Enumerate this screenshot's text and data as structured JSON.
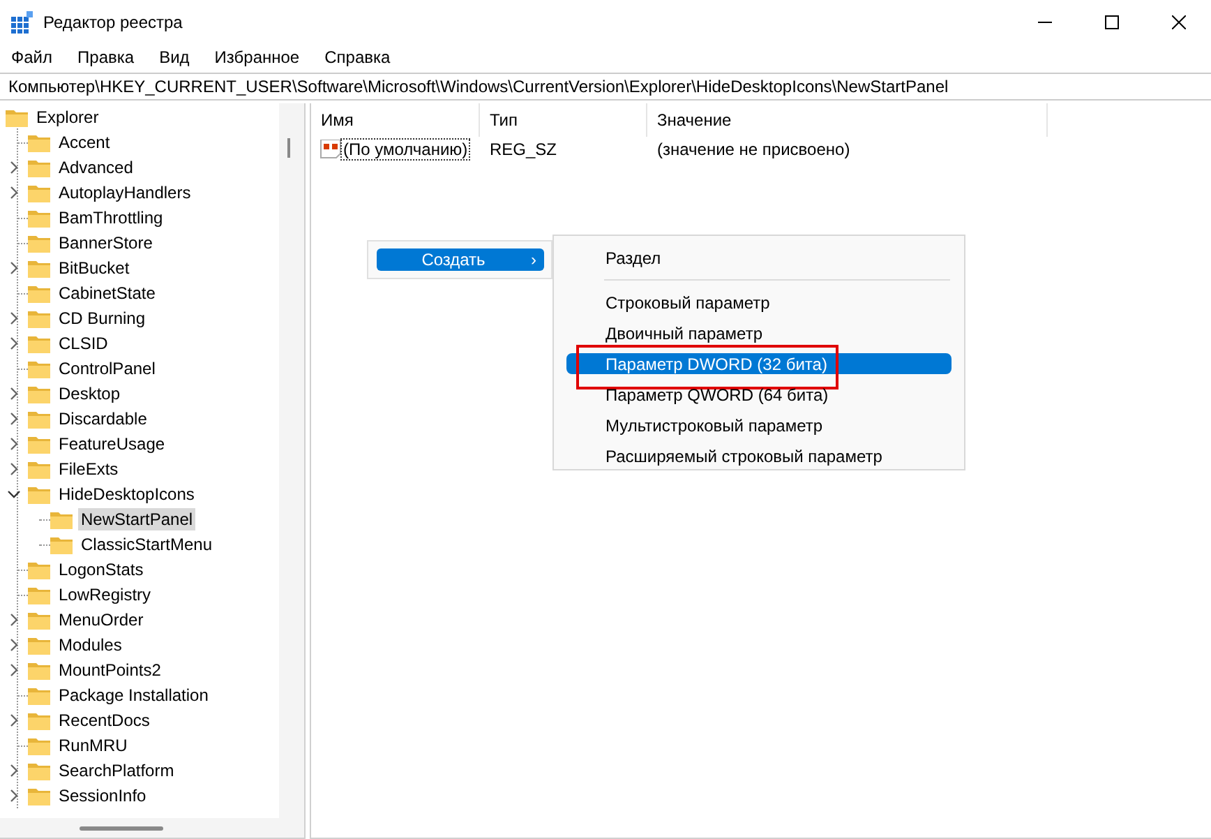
{
  "window": {
    "title": "Редактор реестра"
  },
  "menu_bar": [
    "Файл",
    "Правка",
    "Вид",
    "Избранное",
    "Справка"
  ],
  "address": "Компьютер\\HKEY_CURRENT_USER\\Software\\Microsoft\\Windows\\CurrentVersion\\Explorer\\HideDesktopIcons\\NewStartPanel",
  "tree": {
    "label": "Explorer",
    "selected": false,
    "children": [
      {
        "label": "Accent",
        "expandable": false,
        "selected": false
      },
      {
        "label": "Advanced",
        "expandable": true,
        "expanded": false,
        "selected": false
      },
      {
        "label": "AutoplayHandlers",
        "expandable": true,
        "expanded": false,
        "selected": false
      },
      {
        "label": "BamThrottling",
        "expandable": false,
        "selected": false
      },
      {
        "label": "BannerStore",
        "expandable": false,
        "selected": false
      },
      {
        "label": "BitBucket",
        "expandable": true,
        "expanded": false,
        "selected": false
      },
      {
        "label": "CabinetState",
        "expandable": false,
        "selected": false
      },
      {
        "label": "CD Burning",
        "expandable": true,
        "expanded": false,
        "selected": false
      },
      {
        "label": "CLSID",
        "expandable": true,
        "expanded": false,
        "selected": false
      },
      {
        "label": "ControlPanel",
        "expandable": false,
        "selected": false
      },
      {
        "label": "Desktop",
        "expandable": true,
        "expanded": false,
        "selected": false
      },
      {
        "label": "Discardable",
        "expandable": true,
        "expanded": false,
        "selected": false
      },
      {
        "label": "FeatureUsage",
        "expandable": true,
        "expanded": false,
        "selected": false
      },
      {
        "label": "FileExts",
        "expandable": true,
        "expanded": false,
        "selected": false
      },
      {
        "label": "HideDesktopIcons",
        "expandable": true,
        "expanded": true,
        "selected": false,
        "children": [
          {
            "label": "NewStartPanel",
            "expandable": false,
            "selected": true
          },
          {
            "label": "ClassicStartMenu",
            "expandable": false,
            "selected": false
          }
        ]
      },
      {
        "label": "LogonStats",
        "expandable": false,
        "selected": false
      },
      {
        "label": "LowRegistry",
        "expandable": false,
        "selected": false
      },
      {
        "label": "MenuOrder",
        "expandable": true,
        "expanded": false,
        "selected": false
      },
      {
        "label": "Modules",
        "expandable": true,
        "expanded": false,
        "selected": false
      },
      {
        "label": "MountPoints2",
        "expandable": true,
        "expanded": false,
        "selected": false
      },
      {
        "label": "Package Installation",
        "expandable": false,
        "selected": false
      },
      {
        "label": "RecentDocs",
        "expandable": true,
        "expanded": false,
        "selected": false
      },
      {
        "label": "RunMRU",
        "expandable": false,
        "selected": false
      },
      {
        "label": "SearchPlatform",
        "expandable": true,
        "expanded": false,
        "selected": false
      },
      {
        "label": "SessionInfo",
        "expandable": true,
        "expanded": false,
        "selected": false
      }
    ]
  },
  "table": {
    "columns": [
      "Имя",
      "Тип",
      "Значение"
    ],
    "rows": [
      {
        "name": "(По умолчанию)",
        "type": "REG_SZ",
        "value": "(значение не присвоено)"
      }
    ]
  },
  "context_menu": {
    "items": [
      {
        "label": "Создать",
        "arrow": "›",
        "selected": true
      }
    ]
  },
  "submenu": {
    "items": [
      {
        "label": "Раздел",
        "selected": false,
        "annotated": false,
        "separator_after": true
      },
      {
        "label": "Строковый параметр",
        "selected": false,
        "annotated": false,
        "separator_after": false
      },
      {
        "label": "Двоичный параметр",
        "selected": false,
        "annotated": false,
        "separator_after": false
      },
      {
        "label": "Параметр DWORD (32 бита)",
        "selected": true,
        "annotated": true,
        "separator_after": false
      },
      {
        "label": "Параметр QWORD (64 бита)",
        "selected": false,
        "annotated": false,
        "separator_after": false
      },
      {
        "label": "Мультистроковый параметр",
        "selected": false,
        "annotated": false,
        "separator_after": false
      },
      {
        "label": "Расширяемый строковый параметр",
        "selected": false,
        "annotated": false,
        "separator_after": false
      }
    ]
  }
}
